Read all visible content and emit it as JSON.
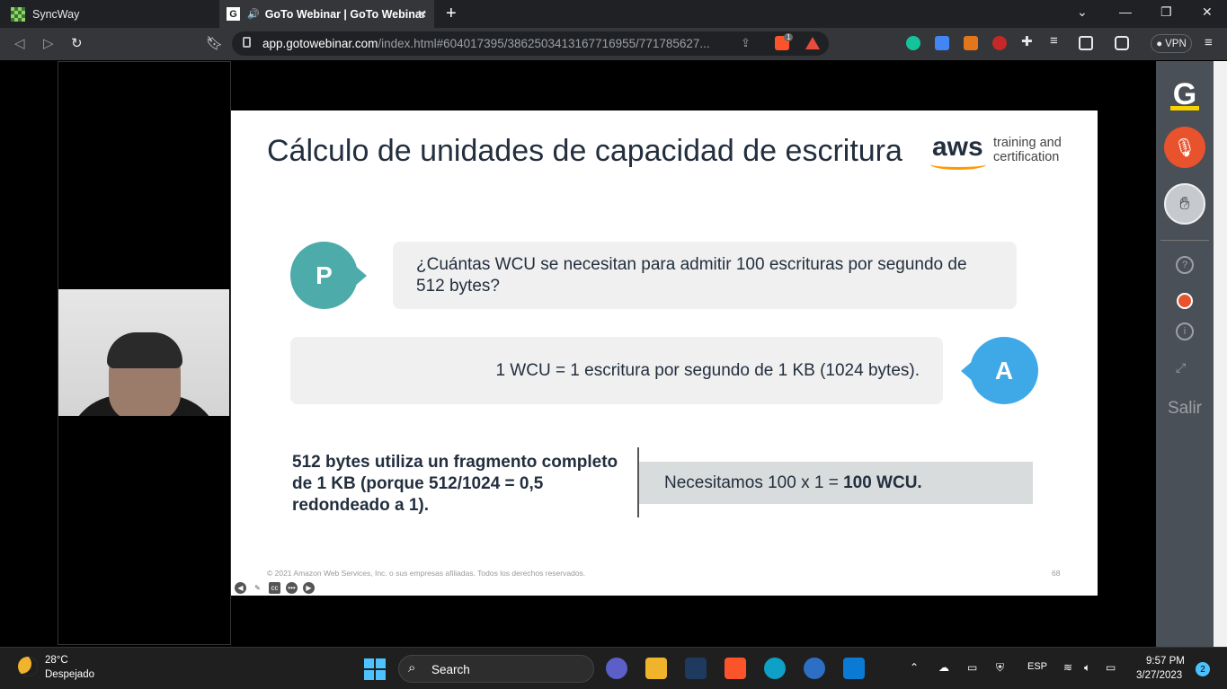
{
  "browser": {
    "tabs": [
      {
        "label": "SyncWay",
        "active": false
      },
      {
        "label": "GoTo Webinar | GoTo Webinar",
        "active": true
      }
    ],
    "url_host": "app.gotowebinar.com",
    "url_path": "/index.html#604017395/3862503413167716955/771785627...",
    "vpn_label": "VPN",
    "brave_badge": "1"
  },
  "slide": {
    "title": "Cálculo de unidades de capacidad de escritura",
    "logo_text": "aws",
    "logo_tagline": "training and certification",
    "question_marker": "P",
    "question": "¿Cuántas WCU se necesitan para admitir 100 escrituras por segundo de 512 bytes?",
    "answer_marker": "A",
    "answer": "1 WCU = 1 escritura por segundo de 1 KB (1024 bytes).",
    "explanation": "512 bytes utiliza un fragmento completo de 1 KB (porque 512/1024 = 0,5 redondeado a 1).",
    "result_prefix": "Necesitamos 100 x 1 = ",
    "result_bold": "100 WCU.",
    "copyright": "© 2021 Amazon Web Services, Inc. o sus empresas afiliadas. Todos los derechos reservados.",
    "page_number": "68"
  },
  "right_panel": {
    "logo": "G",
    "exit_label": "Salir"
  },
  "taskbar": {
    "temperature": "28°C",
    "weather": "Despejado",
    "search_label": "Search",
    "language": "ESP",
    "time": "9:57 PM",
    "date": "3/27/2023",
    "notification_count": "2"
  },
  "colors": {
    "question_bubble": "#4dabaa",
    "answer_bubble": "#3fa9e8",
    "mic_button": "#e8522c",
    "aws_orange": "#ff9900"
  }
}
